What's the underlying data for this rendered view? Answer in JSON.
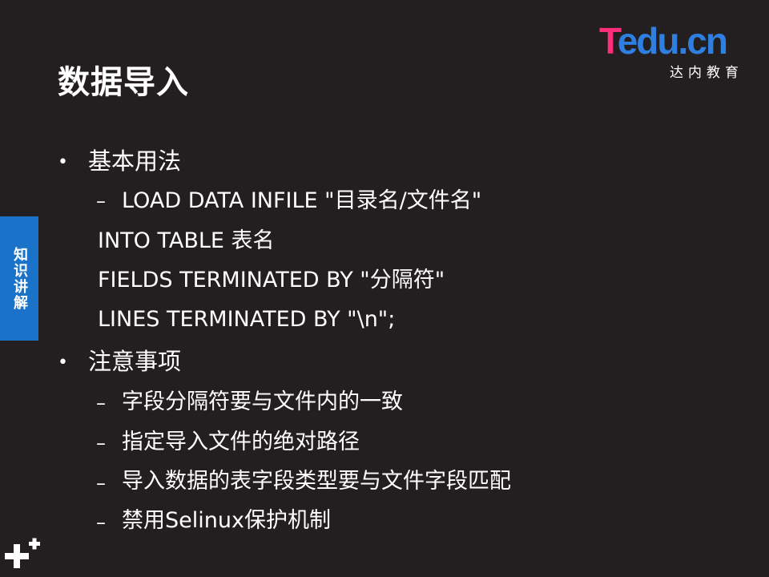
{
  "slide": {
    "title": "数据导入",
    "logo": {
      "brand_t": "T",
      "brand_rest": "edu.cn",
      "subtitle": "达内教育"
    },
    "side_tab": "知识讲解"
  },
  "content": {
    "bullets": [
      {
        "text": "基本用法",
        "lines": [
          "LOAD  DATA  INFILE  \"目录名/文件名\"",
          "INTO TABLE  表名",
          "FIELDS TERMINATED BY  \"分隔符\"",
          "LINES TERMINATED BY  \"\\n\";"
        ]
      },
      {
        "text": "注意事项",
        "items": [
          "字段分隔符要与文件内的一致",
          "指定导入文件的绝对路径",
          "导入数据的表字段类型要与文件字段匹配",
          "禁用Selinux保护机制"
        ]
      }
    ]
  },
  "colors": {
    "background": "#231f20",
    "accent_blue": "#1a73c8",
    "logo_pink": "#ff2d7a",
    "logo_blue": "#2e7fe0"
  },
  "icons": {
    "bullet": "•",
    "dash": "–",
    "corner": "plus-icon"
  }
}
